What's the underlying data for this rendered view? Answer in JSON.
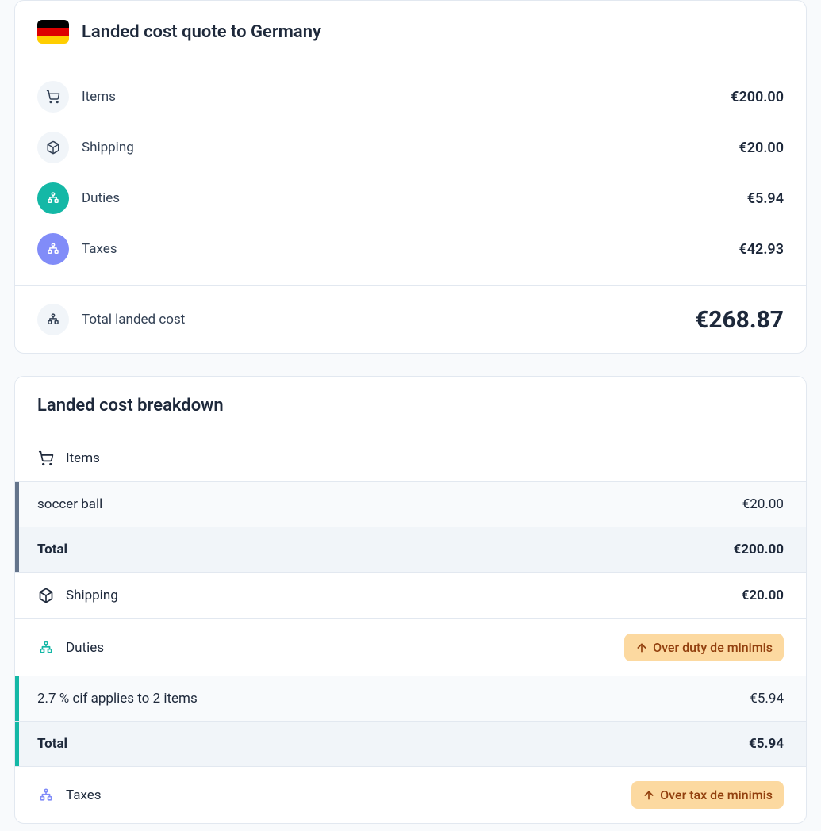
{
  "quote": {
    "title": "Landed cost quote to Germany",
    "flag_colors": [
      "#000000",
      "#dd0000",
      "#ffce00"
    ],
    "rows": {
      "items_label": "Items",
      "items_value": "€200.00",
      "shipping_label": "Shipping",
      "shipping_value": "€20.00",
      "duties_label": "Duties",
      "duties_value": "€5.94",
      "taxes_label": "Taxes",
      "taxes_value": "€42.93"
    },
    "total_label": "Total landed cost",
    "total_value": "€268.87"
  },
  "breakdown": {
    "title": "Landed cost breakdown",
    "items_section_label": "Items",
    "item_name": "soccer ball",
    "item_value": "€20.00",
    "items_total_label": "Total",
    "items_total_value": "€200.00",
    "shipping_label": "Shipping",
    "shipping_value": "€20.00",
    "duties_label": "Duties",
    "duties_badge": "Over duty de minimis",
    "duties_detail": "2.7 % cif applies to 2 items",
    "duties_detail_value": "€5.94",
    "duties_total_label": "Total",
    "duties_total_value": "€5.94",
    "taxes_label": "Taxes",
    "taxes_badge": "Over tax de minimis"
  }
}
